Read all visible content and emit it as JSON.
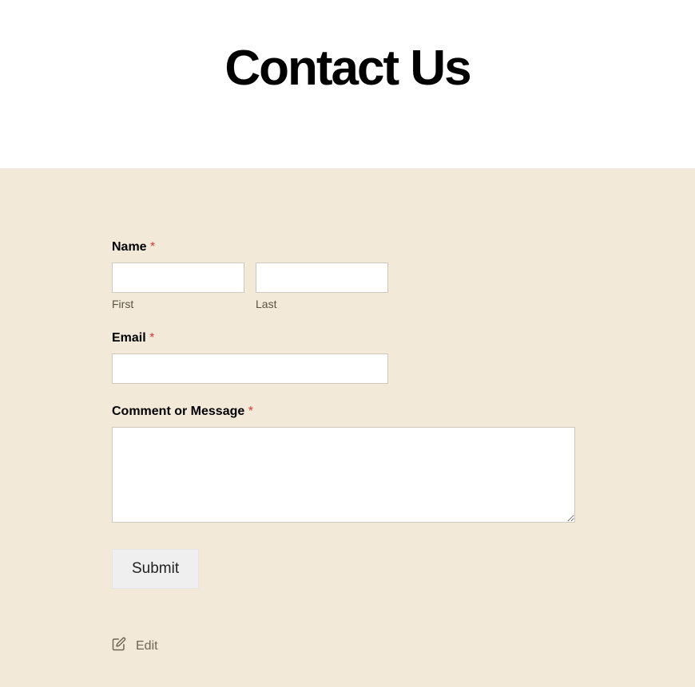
{
  "header": {
    "title": "Contact Us"
  },
  "form": {
    "name": {
      "label": "Name",
      "required": "*",
      "first_sublabel": "First",
      "last_sublabel": "Last",
      "first_value": "",
      "last_value": ""
    },
    "email": {
      "label": "Email",
      "required": "*",
      "value": ""
    },
    "message": {
      "label": "Comment or Message",
      "required": "*",
      "value": ""
    },
    "submit_label": "Submit"
  },
  "footer": {
    "edit_label": "Edit"
  }
}
